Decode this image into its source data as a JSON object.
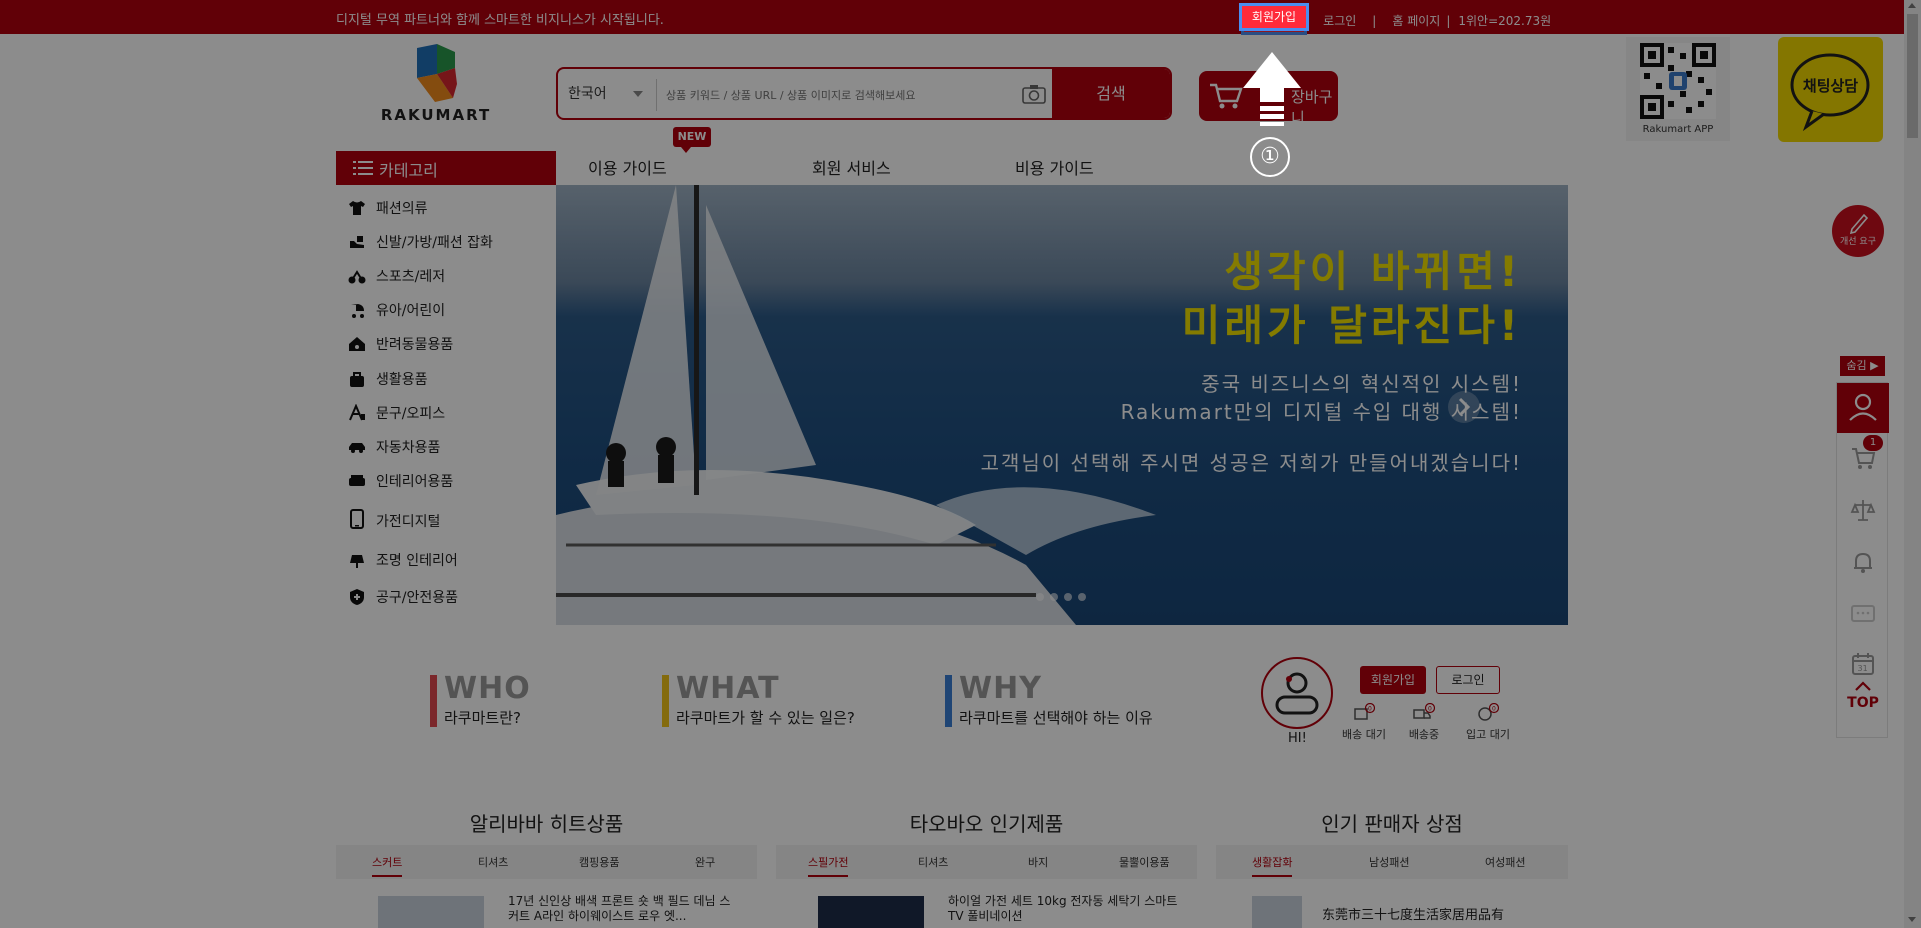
{
  "topbar": {
    "slogan": "디지털 무역 파트너와 함께 스마트한 비지니스가 시작됩니다.",
    "signup": "회원가입",
    "login": "로그인",
    "sep": "|",
    "home": "홈 페이지",
    "sep2": "|",
    "rate": "1위안=202.73원"
  },
  "header": {
    "logo_text": "RAKUMART",
    "search": {
      "language": "한국어",
      "placeholder": "상품 키워드 / 상품 URL / 상품 이미지로 검색해보세요",
      "button": "검색"
    },
    "cart_label": "장바구니",
    "qr_caption": "Rakumart APP",
    "chat_label": "채팅상담"
  },
  "nav": {
    "category": "카테고리",
    "new_badge": "NEW",
    "links": [
      "이용 가이드",
      "회원 서비스",
      "비용 가이드"
    ]
  },
  "categories": [
    {
      "label": "패션의류",
      "icon": "shirt-icon"
    },
    {
      "label": "신발/가방/패션 잡화",
      "icon": "shoe-icon"
    },
    {
      "label": "스포츠/레저",
      "icon": "bike-icon"
    },
    {
      "label": "유아/어린이",
      "icon": "stroller-icon"
    },
    {
      "label": "반려동물용품",
      "icon": "pet-house-icon"
    },
    {
      "label": "생활용품",
      "icon": "bag-icon"
    },
    {
      "label": "문구/오피스",
      "icon": "stationery-icon"
    },
    {
      "label": "자동차용품",
      "icon": "car-icon"
    },
    {
      "label": "인테리어용품",
      "icon": "sofa-icon"
    },
    {
      "label": "가전디지털",
      "icon": "phone-icon"
    },
    {
      "label": "조명 인테리어",
      "icon": "lamp-icon"
    },
    {
      "label": "공구/안전용품",
      "icon": "shield-icon"
    }
  ],
  "banner": {
    "headline1": "생각이 바뀌면!",
    "headline2": "미래가 달라진다!",
    "sub1": "중국 비즈니스의 혁신적인 시스템!",
    "sub2": "Rakumart만의 디지털 수입 대행 시스템!",
    "sub3": "고객님이 선택해 주시면 성공은 저희가 만들어내겠습니다!"
  },
  "why": [
    {
      "big": "WHO",
      "small": "라쿠마트란?",
      "color": "#e0474f"
    },
    {
      "big": "WHAT",
      "small": "라쿠마트가 할 수 있는 일은?",
      "color": "#f0c419"
    },
    {
      "big": "WHY",
      "small": "라쿠마트를 선택해야 하는 이유",
      "color": "#3a7fd5"
    }
  ],
  "userbox": {
    "hi": "HI!",
    "signup": "회원가입",
    "login": "로그인",
    "stats": [
      {
        "label": "배송 대기",
        "count": "0"
      },
      {
        "label": "배송중",
        "count": "0"
      },
      {
        "label": "입고 대기",
        "count": "0"
      }
    ]
  },
  "panels": [
    {
      "title": "알리바바 히트상품",
      "tabs": [
        "스커트",
        "티셔츠",
        "캠핑용품",
        "완구"
      ],
      "item": "17년 신인상 배색 프론트 숏 백 필드 데님 스커트 A라인 하이웨이스트 로우 엣..."
    },
    {
      "title": "타오바오 인기제품",
      "tabs": [
        "스필가전",
        "티셔츠",
        "바지",
        "물뿔이용품"
      ],
      "item": "하이얼 가전 세트 10kg 전자동 세탁기 스마트 TV 풀비네이션"
    },
    {
      "title": "인기 판매자 상점",
      "tabs": [
        "생활잡화",
        "남성패션",
        "여성패션"
      ],
      "item": "东莞市三十七度生活家居用品有"
    }
  ],
  "rail": {
    "improve": "개선 요구",
    "hide": "숨김 ▶",
    "cart_badge": "1",
    "top": "TOP"
  },
  "annotation": {
    "step": "①"
  },
  "colors": {
    "brand_red": "#b1000e",
    "highlight_blue": "#4b8df0",
    "banner_yellow": "#f1e000"
  }
}
